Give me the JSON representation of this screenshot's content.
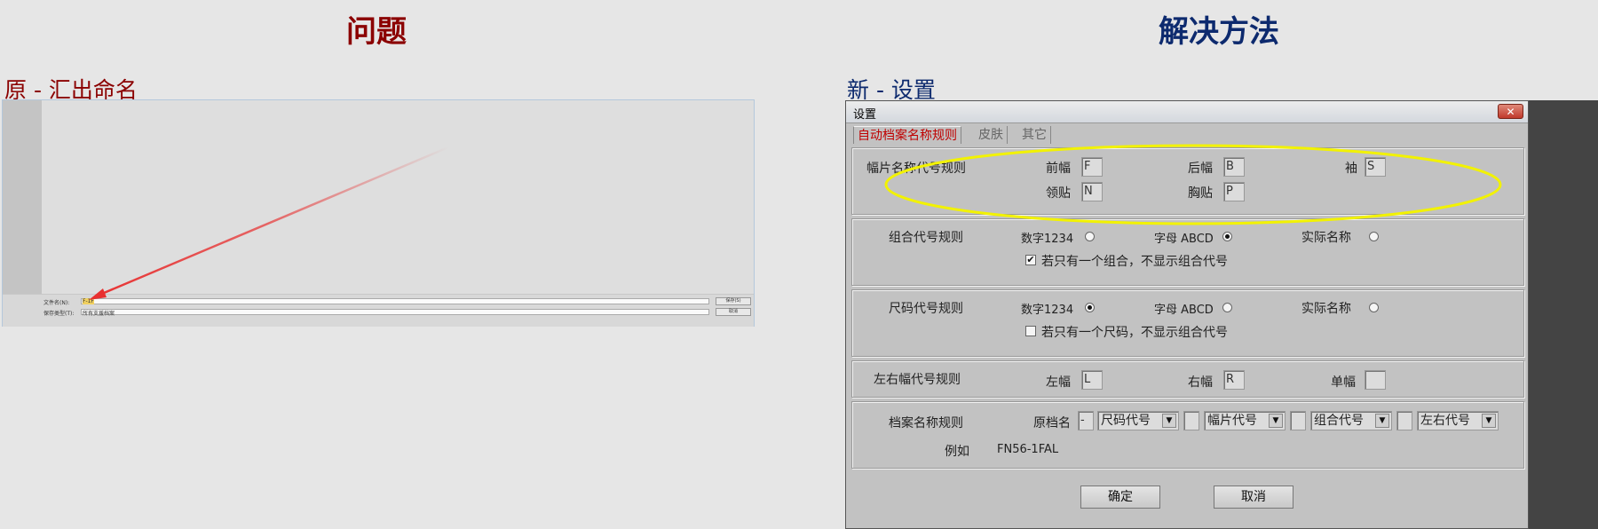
{
  "colors": {
    "problem": "#8b0000",
    "solution": "#0d2a6e",
    "active_tab": "#c00000",
    "ellipse": "#f2f200",
    "arrow": "#e83030"
  },
  "left": {
    "heading": "问题",
    "subtitle": "原 - 汇出命名",
    "filename_label": "文件名(N):",
    "filename_value": "F-1F",
    "filetype_label": "保存类型(T):",
    "filetype_value": "所有支援档案",
    "save_button": "保存(S)",
    "cancel_button": "取消"
  },
  "right": {
    "heading": "解决方法",
    "subtitle": "新 - 设置"
  },
  "dialog": {
    "title": "设置",
    "close": "✕",
    "tabs": [
      "自动档案名称规则",
      "皮肤",
      "其它"
    ],
    "piece_rule": {
      "label": "幅片名称代号规则",
      "front_label": "前幅",
      "front_value": "F",
      "back_label": "后幅",
      "back_value": "B",
      "sleeve_label": "袖",
      "sleeve_value": "S",
      "collar_label": "领贴",
      "collar_value": "N",
      "chest_label": "胸贴",
      "chest_value": "P"
    },
    "combo_rule": {
      "label": "组合代号规则",
      "opt_number": "数字1234",
      "opt_letter": "字母 ABCD",
      "opt_actual": "实际名称",
      "checkbox_label": "若只有一个组合，不显示组合代号",
      "checkbox_mark": "✔"
    },
    "size_rule": {
      "label": "尺码代号规则",
      "opt_number": "数字1234",
      "opt_letter": "字母 ABCD",
      "opt_actual": "实际名称",
      "checkbox_label": "若只有一个尺码，不显示组合代号"
    },
    "lr_rule": {
      "label": "左右幅代号规则",
      "left_label": "左幅",
      "left_value": "L",
      "right_label": "右幅",
      "right_value": "R",
      "single_label": "单幅",
      "single_value": ""
    },
    "name_rule": {
      "label": "档案名称规则",
      "orig_label": "原档名",
      "sep1": "-",
      "sel_size": "尺码代号",
      "sel_piece": "幅片代号",
      "sel_combo": "组合代号",
      "sel_lr": "左右代号",
      "example_label": "例如",
      "example_value": "FN56-1FAL"
    },
    "ok_button": "确定",
    "cancel_button": "取消"
  }
}
